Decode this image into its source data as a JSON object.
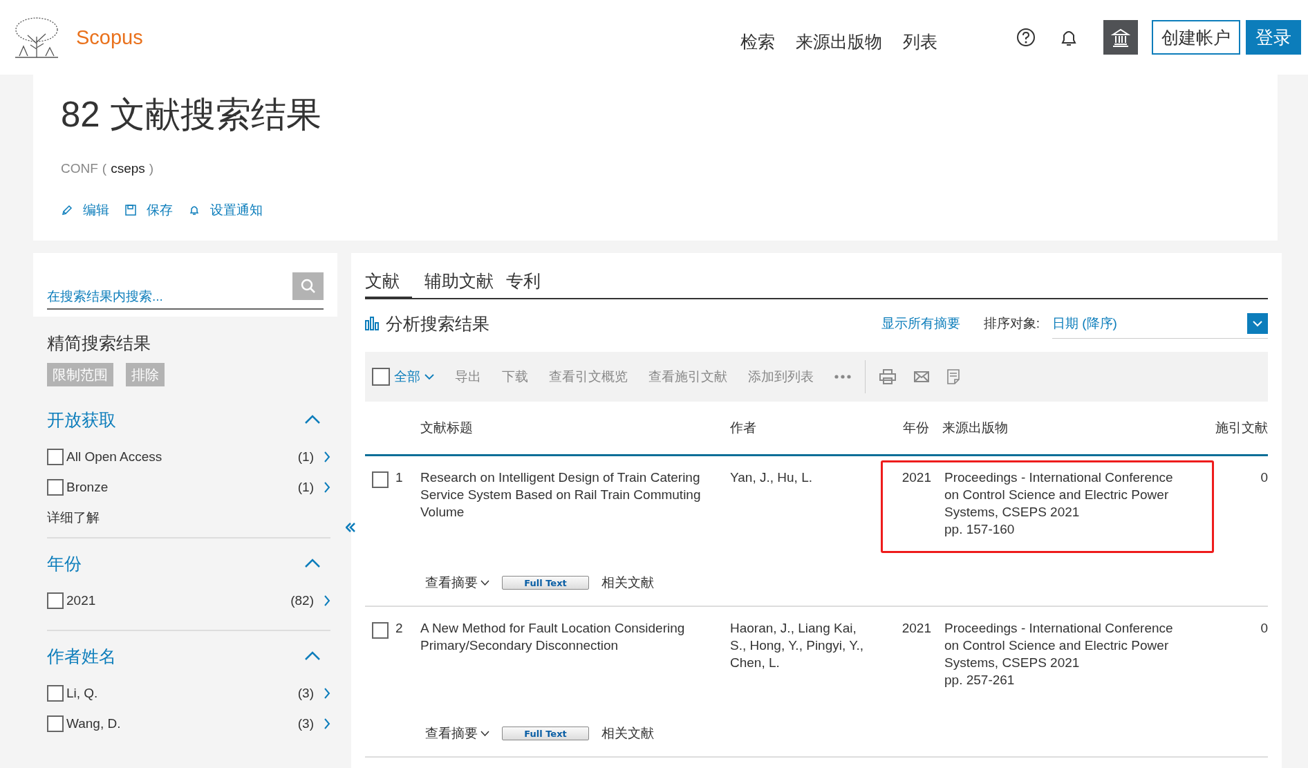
{
  "header": {
    "logo_text": "Scopus",
    "nav": [
      "检索",
      "来源出版物",
      "列表"
    ],
    "create_account": "创建帐户",
    "login": "登录"
  },
  "summary": {
    "title": "82 文献搜索结果",
    "query_field": "CONF",
    "query_open": "(",
    "query_term": "cseps",
    "query_close": ")",
    "actions": [
      "编辑",
      "保存",
      "设置通知"
    ]
  },
  "filters": {
    "search_placeholder": "在搜索结果内搜索...",
    "heading": "精简搜索结果",
    "buttons": [
      "限制范围",
      "排除"
    ],
    "groups": [
      {
        "title": "开放获取",
        "expanded": true,
        "options": [
          {
            "label": "All Open Access",
            "count": "(1)",
            "checked": false
          },
          {
            "label": "Bronze",
            "count": "(1)",
            "checked": false
          }
        ],
        "more": "详细了解"
      },
      {
        "title": "年份",
        "expanded": true,
        "options": [
          {
            "label": "2021",
            "count": "(82)",
            "checked": false
          }
        ]
      },
      {
        "title": "作者姓名",
        "expanded": true,
        "options": [
          {
            "label": "Li, Q.",
            "count": "(3)",
            "checked": false
          },
          {
            "label": "Wang, D.",
            "count": "(3)",
            "checked": false
          }
        ]
      }
    ]
  },
  "results": {
    "tabs": [
      {
        "label": "文献",
        "selected": true
      },
      {
        "label": "辅助文献",
        "selected": false
      },
      {
        "label": "专利",
        "selected": false
      }
    ],
    "analyze": "分析搜索结果",
    "show_abstracts": "显示所有摘要",
    "sort_label": "排序对象:",
    "sort_value": "日期 (降序)",
    "toolbar": {
      "select_all": "全部",
      "select_all_checked": false,
      "actions": [
        "导出",
        "下载",
        "查看引文概览",
        "查看施引文献",
        "添加到列表"
      ]
    },
    "columns": [
      "文献标题",
      "作者",
      "年份",
      "来源出版物",
      "施引文献"
    ],
    "rows": [
      {
        "number": "1",
        "checked": false,
        "highlighted": true,
        "title": "Research on Intelligent Design of Train Catering Service System Based on Rail Train Commuting Volume",
        "authors": "Yan, J., Hu, L.",
        "year": "2021",
        "source": "Proceedings - International Conference on Control Science and Electric Power Systems, CSEPS 2021",
        "pages": "pp. 157-160",
        "citations": "0",
        "abstract_link": "查看摘要",
        "full_text": "Full Text",
        "related": "相关文献"
      },
      {
        "number": "2",
        "checked": false,
        "highlighted": false,
        "title": "A New Method for Fault Location Considering Primary/Secondary Disconnection",
        "authors": "Haoran, J., Liang Kai, S., Hong, Y., Pingyi, Y., Chen, L.",
        "year": "2021",
        "source": "Proceedings - International Conference on Control Science and Electric Power Systems, CSEPS 2021",
        "pages": "pp. 257-261",
        "citations": "0",
        "abstract_link": "查看摘要",
        "full_text": "Full Text",
        "related": "相关文献"
      }
    ]
  }
}
